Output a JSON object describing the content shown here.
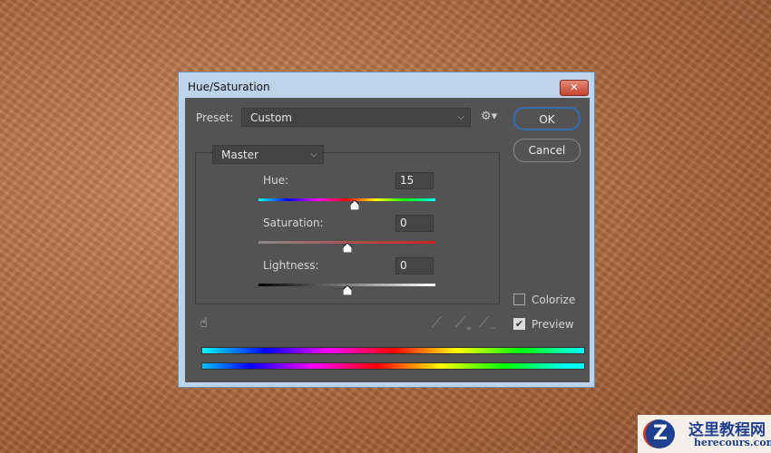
{
  "dialog": {
    "title": "Hue/Saturation",
    "close": "✕"
  },
  "preset": {
    "label": "Preset:",
    "value": "Custom"
  },
  "buttons": {
    "ok": "OK",
    "cancel": "Cancel"
  },
  "channel": "Master",
  "sliders": [
    {
      "label": "Hue:",
      "value": "15",
      "num": 15,
      "min": -180,
      "max": 180
    },
    {
      "label": "Saturation:",
      "value": "0",
      "num": 0,
      "min": -100,
      "max": 100
    },
    {
      "label": "Lightness:",
      "value": "0",
      "num": 0,
      "min": -100,
      "max": 100
    }
  ],
  "colorize": {
    "label": "Colorize",
    "checked": false
  },
  "preview": {
    "label": "Preview",
    "checked": true
  },
  "watermark": {
    "cn": "这里教程网",
    "url": "herecours.com"
  }
}
